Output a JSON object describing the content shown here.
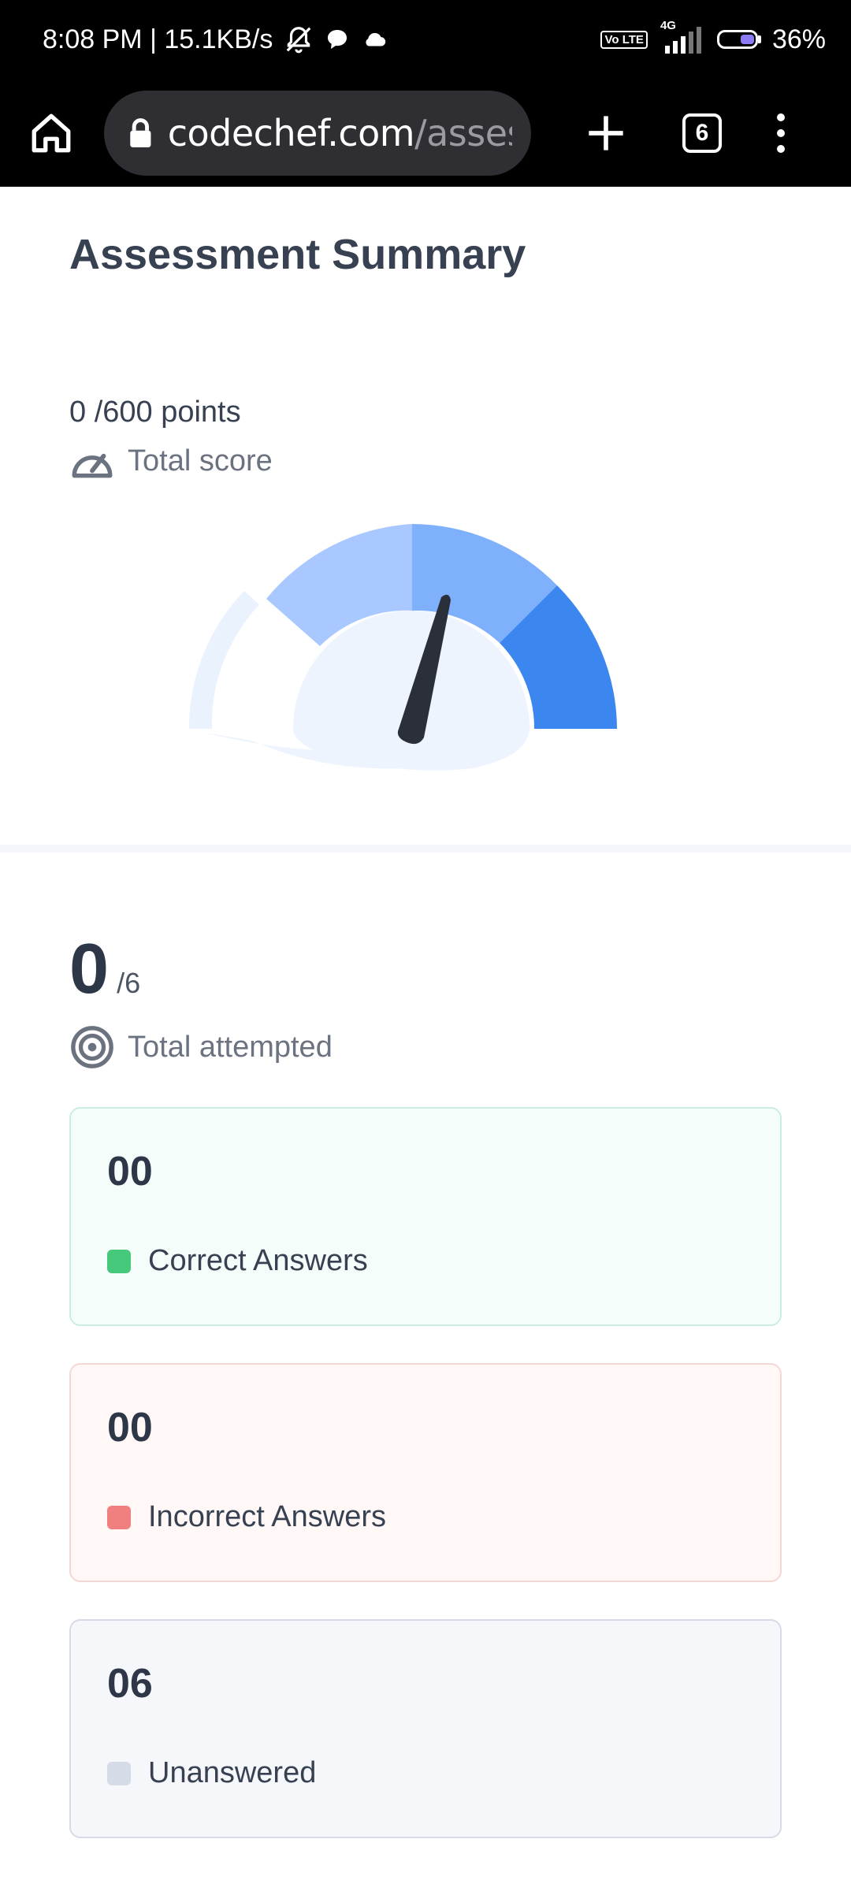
{
  "status_bar": {
    "time_speed": "8:08 PM | 15.1KB/s",
    "volte_badge": "Vo LTE",
    "network_type": "4G",
    "battery": "36%",
    "battery_level": 0.36,
    "icons": [
      "bell-off-icon",
      "chat-bubble-icon",
      "cloud-icon",
      "signal-icon",
      "battery-icon"
    ]
  },
  "browser": {
    "url_host": "codechef.com",
    "url_path": "/asses",
    "tab_count": "6",
    "icons": [
      "home-icon",
      "lock-icon",
      "plus-icon",
      "tabs-icon",
      "more-vert-icon"
    ]
  },
  "summary": {
    "title": "Assessment Summary",
    "score_text": "0 /600 points",
    "score_label": "Total score",
    "score_value": 0,
    "score_max": 600
  },
  "attempted": {
    "count": "0",
    "total": "/6",
    "label": "Total attempted"
  },
  "cards": {
    "correct": {
      "count": "00",
      "label": "Correct Answers",
      "color": "#47c97b"
    },
    "incorrect": {
      "count": "00",
      "label": "Incorrect Answers",
      "color": "#f08080"
    },
    "unanswered": {
      "count": "06",
      "label": "Unanswered",
      "color": "#d5dce8"
    }
  },
  "gauge_colors": {
    "segment_1": "#ffffff",
    "segment_2": "#a8c8ff",
    "segment_3": "#7fb0fb",
    "segment_4": "#3c86ef",
    "needle": "#2b2f3a",
    "hub": "#eef4fe"
  }
}
